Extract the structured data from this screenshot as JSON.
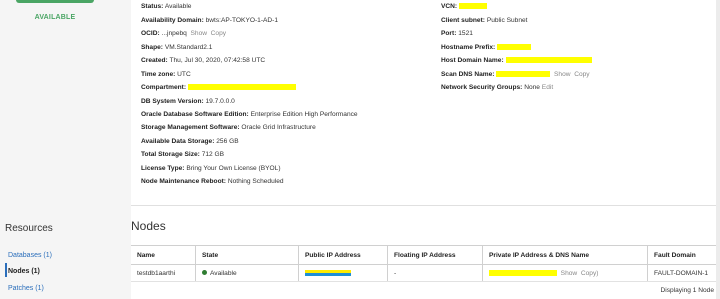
{
  "status_badge": "AVAILABLE",
  "details": {
    "status": {
      "label": "Status:",
      "value": "Available"
    },
    "ad": {
      "label": "Availability Domain:",
      "value": "bwts:AP-TOKYO-1-AD-1"
    },
    "ocid": {
      "label": "OCID:",
      "value": "...jnpebq",
      "show": "Show",
      "copy": "Copy"
    },
    "shape": {
      "label": "Shape:",
      "value": "VM.Standard2.1"
    },
    "created": {
      "label": "Created:",
      "value": "Thu, Jul 30, 2020, 07:42:58 UTC"
    },
    "timezone": {
      "label": "Time zone:",
      "value": "UTC"
    },
    "compartment": {
      "label": "Compartment:"
    },
    "dbver": {
      "label": "DB System Version:",
      "value": "19.7.0.0.0"
    },
    "edition": {
      "label": "Oracle Database Software Edition:",
      "value": "Enterprise Edition High Performance"
    },
    "storage_mgmt": {
      "label": "Storage Management Software:",
      "value": "Oracle Grid Infrastructure"
    },
    "avail_storage": {
      "label": "Available Data Storage:",
      "value": "256 GB"
    },
    "total_storage": {
      "label": "Total Storage Size:",
      "value": "712 GB"
    },
    "license": {
      "label": "License Type:",
      "value": "Bring Your Own License (BYOL)"
    },
    "maint": {
      "label": "Node Maintenance Reboot:",
      "value": "Nothing Scheduled"
    },
    "vcn": {
      "label": "VCN:"
    },
    "subnet": {
      "label": "Client subnet:",
      "value": "Public Subnet"
    },
    "port": {
      "label": "Port:",
      "value": "1521"
    },
    "hostprefix": {
      "label": "Hostname Prefix:"
    },
    "hostdomain": {
      "label": "Host Domain Name:"
    },
    "scandns": {
      "label": "Scan DNS Name:",
      "show": "Show",
      "copy": "Copy"
    },
    "nsg": {
      "label": "Network Security Groups:",
      "value": "None",
      "edit": "Edit"
    }
  },
  "resources": {
    "title": "Resources",
    "items": [
      {
        "label": "Databases (1)"
      },
      {
        "label": "Nodes (1)"
      },
      {
        "label": "Patches (1)"
      }
    ]
  },
  "nodes": {
    "title": "Nodes",
    "columns": [
      "Name",
      "State",
      "Public IP Address",
      "Floating IP Address",
      "Private IP Address & DNS Name",
      "Fault Domain"
    ],
    "rows": [
      {
        "name": "testdb1aarthi",
        "state": "Available",
        "floating": "-",
        "show": "Show",
        "copy": "Copy)",
        "fault": "FAULT-DOMAIN-1"
      }
    ],
    "footer": "Displaying 1 Node"
  }
}
